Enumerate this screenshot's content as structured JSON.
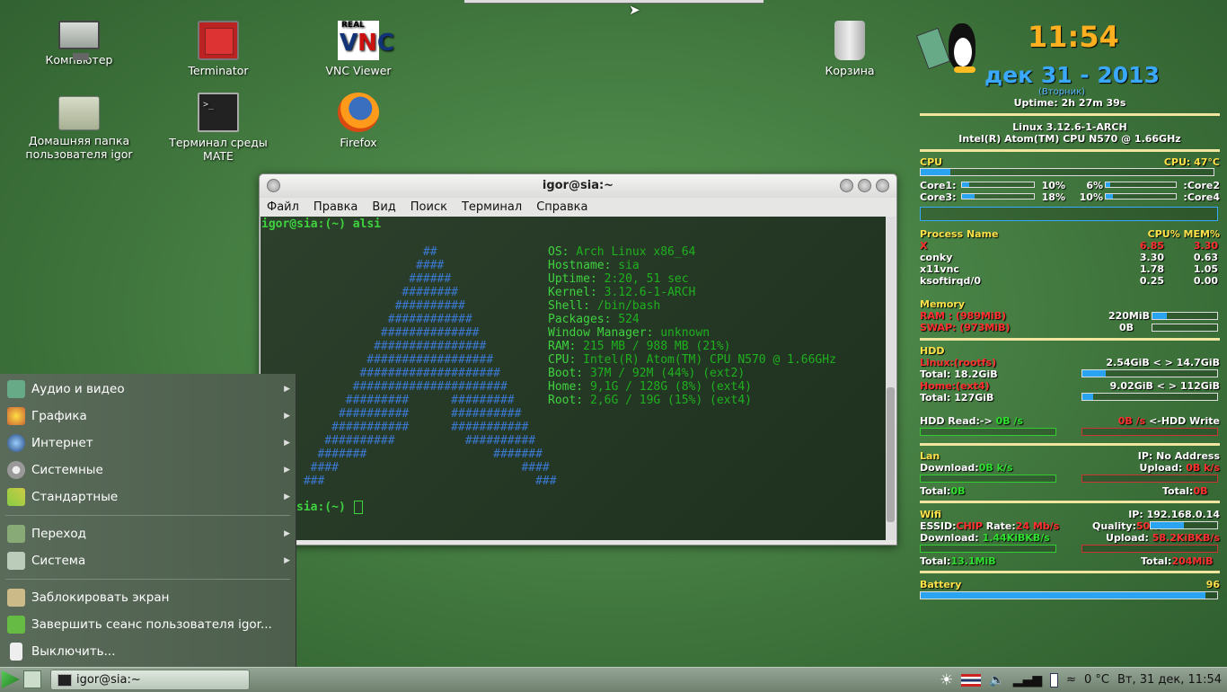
{
  "desktop": {
    "icons": [
      {
        "label": "Компьютер",
        "icon": "computer-icon"
      },
      {
        "label": "Terminator",
        "icon": "terminator-icon"
      },
      {
        "label": "VNC Viewer",
        "icon": "vnc-icon"
      },
      {
        "label": "Корзина",
        "icon": "trash-icon"
      },
      {
        "label": "Домашняя папка пользователя igor",
        "icon": "home-folder-icon"
      },
      {
        "label": "Терминал среды MATE",
        "icon": "terminal-icon"
      },
      {
        "label": "Firefox",
        "icon": "firefox-icon"
      }
    ]
  },
  "terminal": {
    "title": "igor@sia:~",
    "menu": [
      "Файл",
      "Правка",
      "Вид",
      "Поиск",
      "Терминал",
      "Справка"
    ],
    "prompt1": "igor@sia:(~) alsi",
    "prompt2": "sia:(~)",
    "info": [
      {
        "k": "OS:",
        "v": "Arch Linux x86_64"
      },
      {
        "k": "Hostname:",
        "v": "sia"
      },
      {
        "k": "Uptime:",
        "v": "2:20, 51 sec"
      },
      {
        "k": "Kernel:",
        "v": "3.12.6-1-ARCH"
      },
      {
        "k": "Shell:",
        "v": "/bin/bash"
      },
      {
        "k": "Packages:",
        "v": "524"
      },
      {
        "k": "Window Manager:",
        "v": "unknown"
      },
      {
        "k": "RAM:",
        "v": "215 MB / 988 MB (21%)"
      },
      {
        "k": "CPU:",
        "v": "Intel(R) Atom(TM) CPU N570 @ 1.66GHz"
      },
      {
        "k": "Boot:",
        "v": "37M / 92M (44%) (ext2)"
      },
      {
        "k": "Home:",
        "v": "9,1G / 128G (8%) (ext4)"
      },
      {
        "k": "Root:",
        "v": "2,6G / 19G (15%) (ext4)"
      }
    ]
  },
  "menu": {
    "items": [
      "Аудио и видео",
      "Графика",
      "Интернет",
      "Системные",
      "Стандартные"
    ],
    "items2": [
      "Переход",
      "Система"
    ],
    "items3": [
      "Заблокировать экран",
      "Завершить сеанс пользователя igor...",
      "Выключить..."
    ]
  },
  "panel": {
    "task": "igor@sia:~",
    "temp": "0 °C",
    "clock": "Вт, 31 дек, 11:54"
  },
  "conky": {
    "time": "11:54",
    "date": "дек 31 - 2013",
    "weekday": "(Вторник)",
    "uptime": "Uptime: 2h 27m 39s",
    "kernel": "Linux 3.12.6-1-ARCH",
    "cpu_model": "Intel(R) Atom(TM) CPU N570 @ 1.66GHz",
    "cpu_label": "CPU",
    "cpu_temp": "CPU: 47°C",
    "core1": "Core1:",
    "core1_v": "10%",
    "core2_v": "6%",
    "core2": ":Core2",
    "core3": "Core3:",
    "core3_v": "18%",
    "core4_v": "10%",
    "core4": ":Core4",
    "cpu_pct": 10,
    "core1_pct": 10,
    "core2_pct": 6,
    "core3_pct": 18,
    "core4_pct": 10,
    "proc_head": "Process Name",
    "proc_cols": "CPU% MEM%",
    "procs": [
      {
        "n": "X",
        "c": "6.85",
        "m": "3.30"
      },
      {
        "n": "conky",
        "c": "3.30",
        "m": "0.63"
      },
      {
        "n": "x11vnc",
        "c": "1.78",
        "m": "1.05"
      },
      {
        "n": "ksoftirqd/0",
        "c": "0.25",
        "m": "0.00"
      }
    ],
    "memory": "Memory",
    "ram": "RAM : (989MiB)",
    "ram_used": "220MiB",
    "ram_pct": 22,
    "swap": "SWAP: (973MiB)",
    "swap_used": "0B",
    "swap_pct": 0,
    "hdd": "HDD",
    "root": "Linux:(rootfs)",
    "root_v": "2.54GiB  <  >  14.7GiB",
    "root_total": "Total: 18.2GiB",
    "root_pct": 17,
    "home": "Home:(ext4)",
    "home_v": "9.02GiB  <  >  112GiB",
    "home_total": "Total: 127GiB",
    "home_pct": 8,
    "hdd_read": "HDD Read:->",
    "hdd_read_v": "0B",
    "hdd_read_u": "/s",
    "hdd_write_v": "0B",
    "hdd_write_u": "/s",
    "hdd_write": "<-HDD Write",
    "lan": "Lan",
    "lan_ip": "IP: No Address",
    "lan_down": "Download:",
    "lan_down_v": "0B",
    "lan_down_u": "k/s",
    "lan_up": "Upload:",
    "lan_up_v": "0B",
    "lan_up_u": "k/s",
    "lan_total1": "Total:",
    "lan_total1_v": "0B",
    "lan_total2": "Total:",
    "lan_total2_v": "0B",
    "wifi": "Wifi",
    "wifi_ip": "IP: 192.168.0.14",
    "essid": "ESSID:",
    "essid_v": "CHIP",
    "rate": "Rate:",
    "rate_v": "24 Mb/s",
    "quality": "Quality:",
    "quality_v": "50%",
    "quality_pct": 50,
    "wifi_down": "Download:",
    "wifi_down_v": "1.44KiBKB/s",
    "wifi_up": "Upload:",
    "wifi_up_v": "58.2KiBKB/s",
    "wifi_total1": "Total:",
    "wifi_total1_v": "13.1MiB",
    "wifi_total2": "Total:",
    "wifi_total2_v": "204MiB",
    "battery": "Battery",
    "battery_v": "96",
    "battery_pct": 96
  }
}
